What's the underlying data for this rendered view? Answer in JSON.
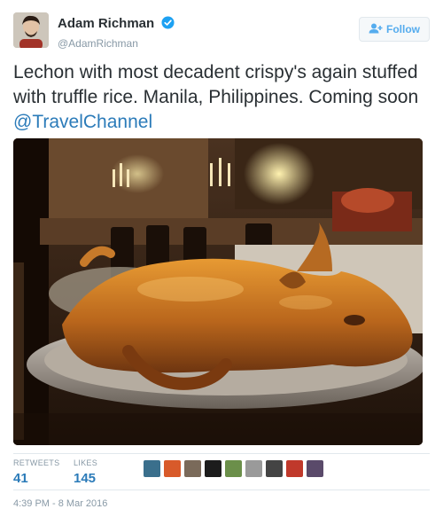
{
  "user": {
    "display_name": "Adam Richman",
    "handle": "@AdamRichman",
    "verified": true,
    "avatar_icon": "profile-photo-icon"
  },
  "follow_button": {
    "label": "Follow",
    "icon": "add-user-icon",
    "color": "#55acee"
  },
  "tweet": {
    "text": "Lechon with most decadent crispy's again stuffed with truffle rice. Manila, Philippines. Coming soon",
    "mention": "@TravelChannel",
    "mention_color": "#2b7bb9"
  },
  "photo": {
    "subject": "roast-pig-photo"
  },
  "stats": {
    "retweets_label": "RETWEETS",
    "retweets_value": "41",
    "likes_label": "LIKES",
    "likes_value": "145"
  },
  "likers": [
    {
      "icon": "liker-avatar-icon",
      "color": "#3a6f8c"
    },
    {
      "icon": "liker-avatar-icon",
      "color": "#d85a2a"
    },
    {
      "icon": "liker-avatar-icon",
      "color": "#7a6a5a"
    },
    {
      "icon": "liker-avatar-icon",
      "color": "#1c1c1c"
    },
    {
      "icon": "liker-avatar-icon",
      "color": "#6b8f4a"
    },
    {
      "icon": "liker-avatar-icon",
      "color": "#9a9a9a"
    },
    {
      "icon": "liker-avatar-icon",
      "color": "#444444"
    },
    {
      "icon": "liker-avatar-icon",
      "color": "#c0392b"
    },
    {
      "icon": "liker-avatar-icon",
      "color": "#5a4a6a"
    }
  ],
  "timestamp": "4:39 PM - 8 Mar 2016"
}
